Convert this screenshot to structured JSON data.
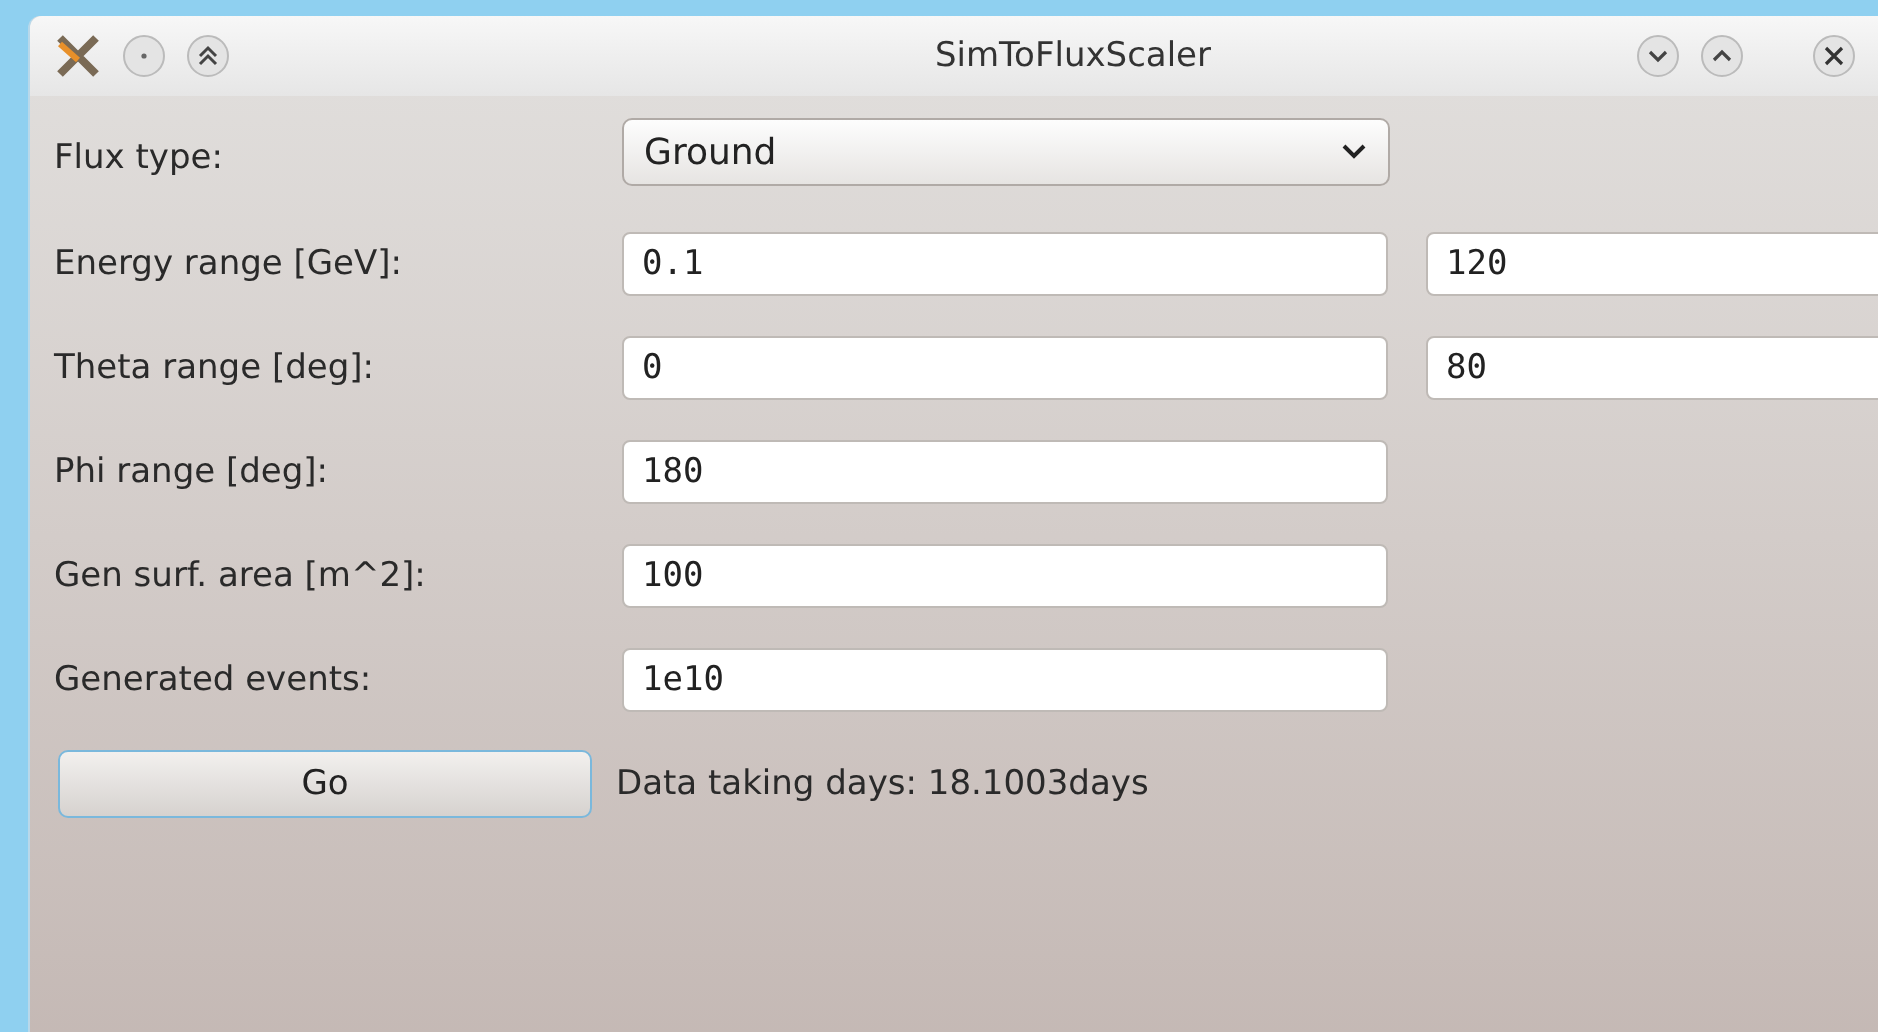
{
  "window": {
    "title": "SimToFluxScaler"
  },
  "rows": [
    {
      "kind": "combo",
      "label": "Flux type:",
      "value": "Ground"
    },
    {
      "kind": "fields",
      "label": "Energy range [GeV]:",
      "values": [
        "0.1",
        "120"
      ]
    },
    {
      "kind": "fields",
      "label": "Theta range [deg]:",
      "values": [
        "0",
        "80"
      ]
    },
    {
      "kind": "fields",
      "label": "Phi range [deg]:",
      "values": [
        "180"
      ]
    },
    {
      "kind": "fields",
      "label": "Gen surf. area [m^2]:",
      "values": [
        "100"
      ]
    },
    {
      "kind": "fields",
      "label": "Generated events:",
      "values": [
        "1e10"
      ]
    }
  ],
  "action": {
    "button": "Go",
    "result": "Data taking days: 18.1003days"
  }
}
